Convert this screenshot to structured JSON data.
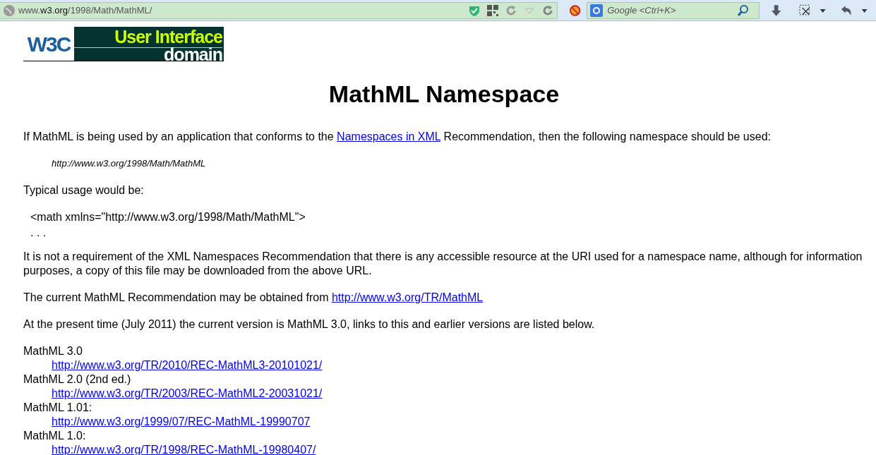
{
  "toolbar": {
    "url": "www.**w3.org**/1998/Math/MathML/",
    "search_placeholder": "Google <Ctrl+K>"
  },
  "logo": {
    "mark": "W3C",
    "title": "User Interface",
    "subtitle": "domain"
  },
  "heading": "MathML Namespace",
  "intro": {
    "before": "If MathML is being used by an application that conforms to the ",
    "link": "Namespaces in XML",
    "after": " Recommendation, then the following namespace should be used:"
  },
  "namespace": "http://www.w3.org/1998/Math/MathML",
  "usage_label": "Typical usage would be:",
  "code_lines": [
    "<math xmlns=\"http://www.w3.org/1998/Math/MathML\">",
    ". . ."
  ],
  "note": "It is not a requirement of the XML Namespaces Recommendation that there is any accessible resource at the URI used for a namespace name, although for information purposes, a copy of this file may be downloaded from the above URL.",
  "current": {
    "before": "The current MathML Recommendation may be obtained from ",
    "link": "http://www.w3.org/TR/MathML"
  },
  "present": "At the present time (July 2011) the current version is MathML 3.0, links to this and earlier versions are listed below.",
  "versions": [
    {
      "label": "MathML 3.0",
      "link": "http://www.w3.org/TR/2010/REC-MathML3-20101021/"
    },
    {
      "label": "MathML 2.0 (2nd ed.)",
      "link": "http://www.w3.org/TR/2003/REC-MathML2-20031021/"
    },
    {
      "label": "MathML 1.01:",
      "link": "http://www.w3.org/1999/07/REC-MathML-19990707"
    },
    {
      "label": "MathML 1.0:",
      "link": "http://www.w3.org/TR/1998/REC-MathML-19980407/"
    }
  ]
}
